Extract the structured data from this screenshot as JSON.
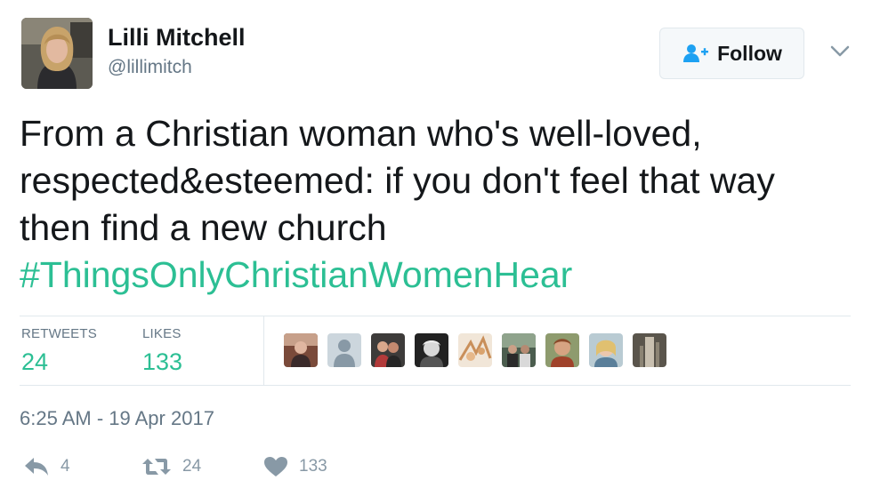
{
  "author": {
    "name": "Lilli Mitchell",
    "handle": "@lillimitch"
  },
  "follow_button": {
    "label": "Follow",
    "icon": "follow-person-plus-icon"
  },
  "menu": {
    "icon": "chevron-down-icon"
  },
  "tweet": {
    "text": "From a Christian woman who's well-loved, respected&esteemed: if you don't feel that way then find a new church",
    "hashtag": "#ThingsOnlyChristianWomenHear"
  },
  "stats": {
    "retweets_label": "RETWEETS",
    "retweets_value": "24",
    "likes_label": "LIKES",
    "likes_value": "133"
  },
  "timestamp": "6:25 AM - 19 Apr 2017",
  "actions": {
    "reply_count": "4",
    "retweet_count": "24",
    "like_count": "133"
  },
  "colors": {
    "accent": "#2cbf94",
    "text": "#14171a",
    "secondary": "#657786",
    "icon": "#8899a6",
    "border": "#e1e8ed",
    "follow_icon": "#1da1f2"
  }
}
